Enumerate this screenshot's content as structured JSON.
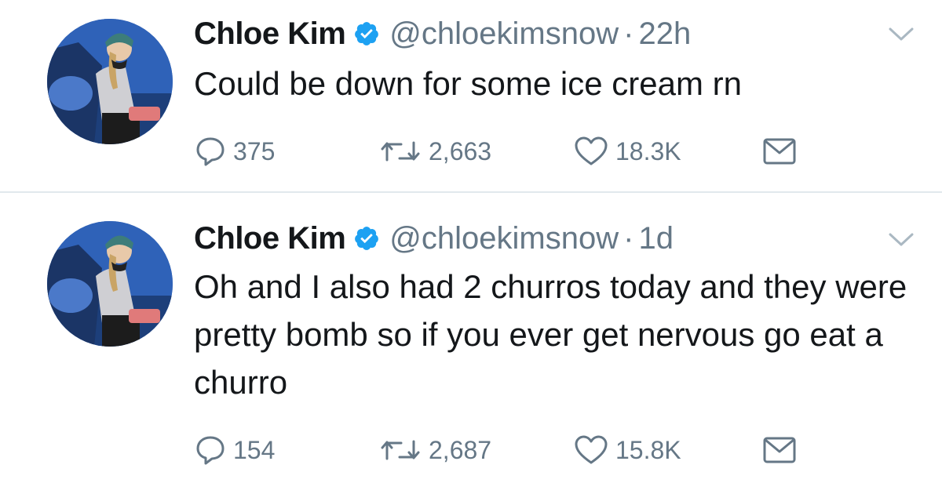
{
  "tweets": [
    {
      "name": "Chloe Kim",
      "handle": "@chloekimsnow",
      "separator": "·",
      "time": "22h",
      "text": "Could be down for some ice cream rn",
      "replies": "375",
      "retweets": "2,663",
      "likes": "18.3K"
    },
    {
      "name": "Chloe Kim",
      "handle": "@chloekimsnow",
      "separator": "·",
      "time": "1d",
      "text": "Oh and I also had 2 churros today and they were pretty bomb so if you ever get nervous go eat a churro",
      "replies": "154",
      "retweets": "2,687",
      "likes": "15.8K"
    }
  ],
  "icons": {
    "verified": "verified-badge-icon",
    "chevron": "chevron-down-icon",
    "reply": "reply-bubble-icon",
    "retweet": "retweet-icon",
    "like": "heart-icon",
    "dm": "envelope-icon"
  },
  "colors": {
    "verified_blue": "#1da1f2",
    "secondary_text": "#657786",
    "primary_text": "#14171a",
    "divider": "#e1e8ed"
  }
}
